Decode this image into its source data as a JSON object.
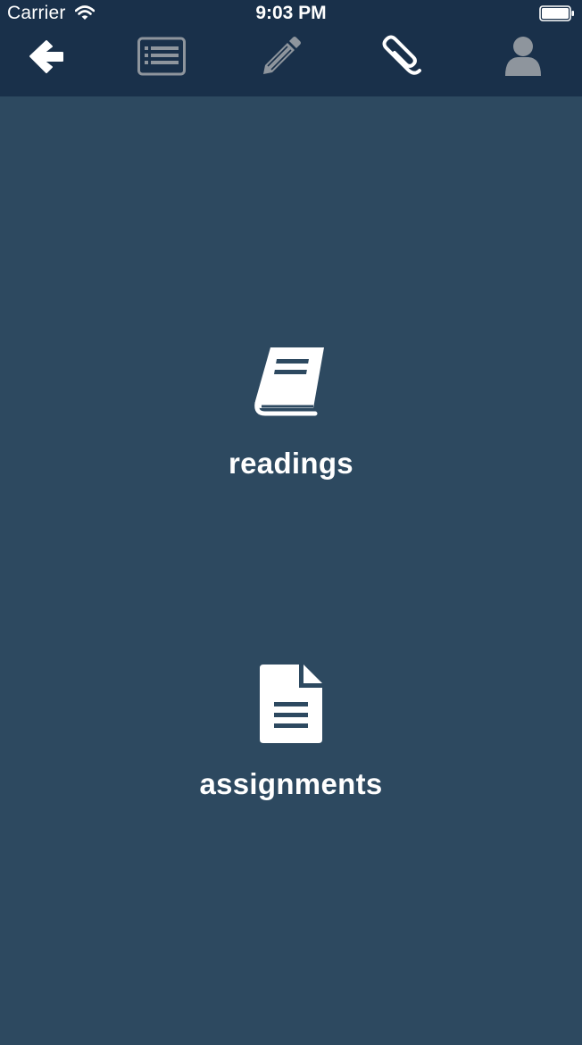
{
  "status_bar": {
    "carrier": "Carrier",
    "time": "9:03 PM"
  },
  "toolbar": {
    "items": [
      {
        "name": "back",
        "icon": "arrow-left-icon",
        "color": "#ffffff"
      },
      {
        "name": "list",
        "icon": "list-icon",
        "color": "#8e959d"
      },
      {
        "name": "edit",
        "icon": "pencil-icon",
        "color": "#8e959d"
      },
      {
        "name": "attachments",
        "icon": "paperclip-icon",
        "color": "#ffffff"
      },
      {
        "name": "profile",
        "icon": "user-icon",
        "color": "#8e959d"
      }
    ]
  },
  "main": {
    "readings_label": "readings",
    "readings_icon": "book-icon",
    "assignments_label": "assignments",
    "assignments_icon": "document-icon"
  },
  "colors": {
    "background": "#2d4960",
    "topbar": "#19304a",
    "active_icon": "#ffffff",
    "inactive_icon": "#8e959d"
  }
}
